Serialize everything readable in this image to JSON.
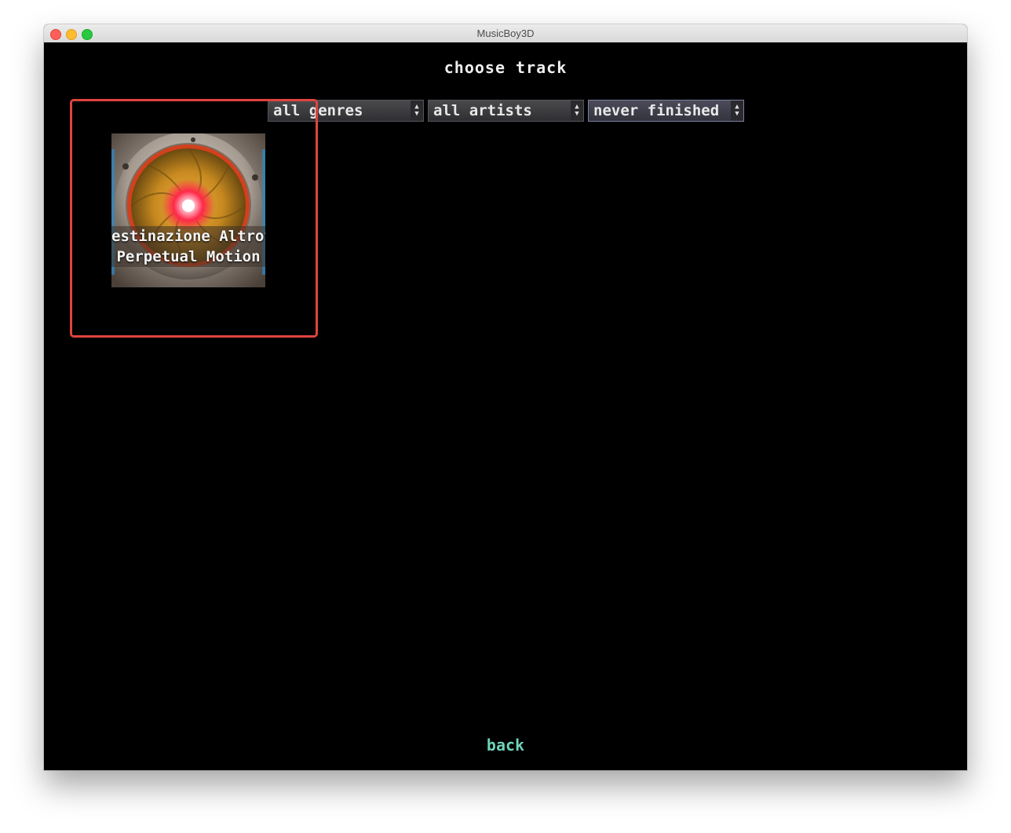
{
  "window": {
    "title": "MusicBoy3D"
  },
  "screen": {
    "heading": "choose track",
    "back_label": "back"
  },
  "filters": {
    "genre": {
      "selected": "all genres"
    },
    "artist": {
      "selected": "all artists"
    },
    "completion": {
      "selected": "never finished"
    }
  },
  "tracks": [
    {
      "artist": "estinazione Altrov",
      "title": "Perpetual Motion"
    }
  ],
  "icons": {
    "select_arrows": "up-down-arrows-icon",
    "cover": "speaker-cover-art"
  },
  "colors": {
    "background": "#000000",
    "back_link": "#6fd3b8",
    "highlight": "#e0443e"
  }
}
